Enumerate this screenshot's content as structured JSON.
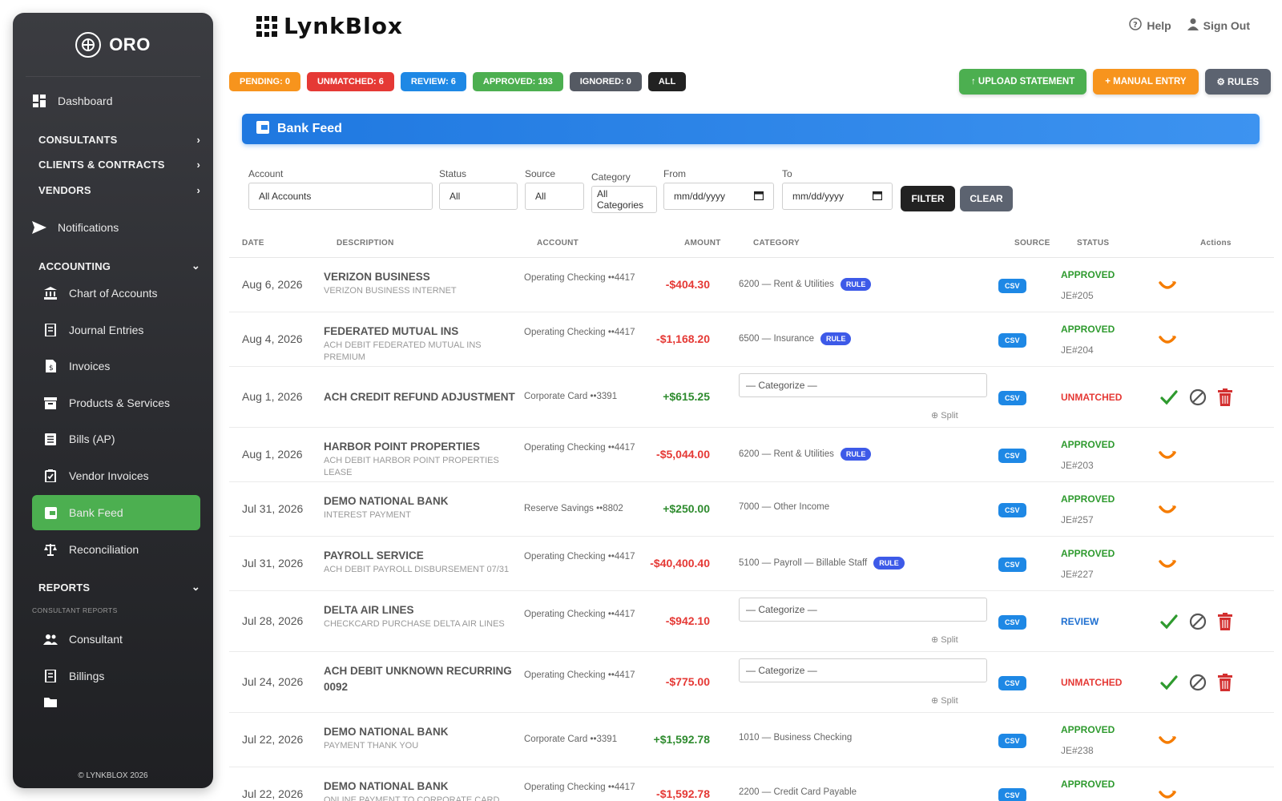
{
  "sidebar": {
    "brand": "ORO",
    "footer": "© LYNKBLOX 2026",
    "dashboard": "Dashboard",
    "sections": {
      "consultants": "CONSULTANTS",
      "clients": "CLIENTS & CONTRACTS",
      "vendors": "VENDORS",
      "accounting": "ACCOUNTING",
      "reports": "REPORTS"
    },
    "notifications": "Notifications",
    "accounting_items": [
      "Chart of Accounts",
      "Journal Entries",
      "Invoices",
      "Products & Services",
      "Bills (AP)",
      "Vendor Invoices",
      "Bank Feed",
      "Reconciliation"
    ],
    "reports_caption": "CONSULTANT REPORTS",
    "reports_items": [
      "Consultant",
      "Billings"
    ]
  },
  "header": {
    "logo": "LynkBlox",
    "help": "Help",
    "signout": "Sign Out"
  },
  "pills": {
    "pending": "PENDING: 0",
    "unmatched": "UNMATCHED: 6",
    "review": "REVIEW: 6",
    "approved": "APPROVED: 193",
    "ignored": "IGNORED: 0",
    "all": "ALL"
  },
  "actions": {
    "upload": "↑ UPLOAD STATEMENT",
    "manual": "+ MANUAL ENTRY",
    "rules": "⚙ RULES"
  },
  "panel": {
    "title": "Bank Feed"
  },
  "filters": {
    "account_label": "Account",
    "account_value": "All Accounts",
    "status_label": "Status",
    "status_value": "All",
    "source_label": "Source",
    "source_value": "All",
    "category_label": "Category",
    "category_value": "All Categories",
    "from_label": "From",
    "from_value": "mm/dd/yyyy",
    "to_label": "To",
    "to_value": "mm/dd/yyyy",
    "filter_btn": "FILTER",
    "clear_btn": "CLEAR"
  },
  "table": {
    "headers": {
      "date": "DATE",
      "description": "DESCRIPTION",
      "account": "ACCOUNT",
      "amount": "AMOUNT",
      "category": "CATEGORY",
      "source": "SOURCE",
      "status": "STATUS",
      "actions": "Actions"
    },
    "categorize_placeholder": "— Categorize —",
    "split_label": "⊕ Split",
    "rule_label": "RULE",
    "csv_label": "CSV",
    "rows": [
      {
        "date": "Aug 6, 2026",
        "title": "VERIZON BUSINESS",
        "sub": "VERIZON BUSINESS INTERNET",
        "account": "Operating Checking ••4417",
        "amount": "-$404.30",
        "sign": "neg",
        "category": "6200 — Rent & Utilities",
        "rule": true,
        "status": "APPROVED",
        "je": "JE#205"
      },
      {
        "date": "Aug 4, 2026",
        "title": "FEDERATED MUTUAL INS",
        "sub": "ACH DEBIT FEDERATED MUTUAL INS PREMIUM",
        "account": "Operating Checking ••4417",
        "amount": "-$1,168.20",
        "sign": "neg",
        "category": "6500 — Insurance",
        "rule": true,
        "status": "APPROVED",
        "je": "JE#204"
      },
      {
        "date": "Aug 1, 2026",
        "title": "ACH CREDIT REFUND ADJUSTMENT",
        "sub": "",
        "account": "Corporate Card ••3391",
        "amount": "+$615.25",
        "sign": "pos",
        "category": "",
        "rule": false,
        "status": "UNMATCHED",
        "je": ""
      },
      {
        "date": "Aug 1, 2026",
        "title": "HARBOR POINT PROPERTIES",
        "sub": "ACH DEBIT HARBOR POINT PROPERTIES LEASE",
        "account": "Operating Checking ••4417",
        "amount": "-$5,044.00",
        "sign": "neg",
        "category": "6200 — Rent & Utilities",
        "rule": true,
        "status": "APPROVED",
        "je": "JE#203"
      },
      {
        "date": "Jul 31, 2026",
        "title": "DEMO NATIONAL BANK",
        "sub": "INTEREST PAYMENT",
        "account": "Reserve Savings ••8802",
        "amount": "+$250.00",
        "sign": "pos",
        "category": "7000 — Other Income",
        "rule": false,
        "status": "APPROVED",
        "je": "JE#257"
      },
      {
        "date": "Jul 31, 2026",
        "title": "PAYROLL SERVICE",
        "sub": "ACH DEBIT PAYROLL DISBURSEMENT 07/31",
        "account": "Operating Checking ••4417",
        "amount": "-$40,400.40",
        "sign": "neg",
        "category": "5100 — Payroll — Billable Staff",
        "rule": true,
        "status": "APPROVED",
        "je": "JE#227"
      },
      {
        "date": "Jul 28, 2026",
        "title": "DELTA AIR LINES",
        "sub": "CHECKCARD PURCHASE DELTA AIR LINES",
        "account": "Operating Checking ••4417",
        "amount": "-$942.10",
        "sign": "neg",
        "category": "",
        "rule": false,
        "status": "REVIEW",
        "je": ""
      },
      {
        "date": "Jul 24, 2026",
        "title": "ACH DEBIT UNKNOWN RECURRING 0092",
        "sub": "",
        "account": "Operating Checking ••4417",
        "amount": "-$775.00",
        "sign": "neg",
        "category": "",
        "rule": false,
        "status": "UNMATCHED",
        "je": ""
      },
      {
        "date": "Jul 22, 2026",
        "title": "DEMO NATIONAL BANK",
        "sub": "PAYMENT THANK YOU",
        "account": "Corporate Card ••3391",
        "amount": "+$1,592.78",
        "sign": "pos",
        "category": "1010 — Business Checking",
        "rule": false,
        "status": "APPROVED",
        "je": "JE#238"
      },
      {
        "date": "Jul 22, 2026",
        "title": "DEMO NATIONAL BANK",
        "sub": "ONLINE PAYMENT TO CORPORATE CARD",
        "account": "Operating Checking ••4417",
        "amount": "-$1,592.78",
        "sign": "neg",
        "category": "2200 — Credit Card Payable",
        "rule": false,
        "status": "APPROVED",
        "je": ""
      }
    ]
  },
  "colors": {
    "pending": "#f7941d",
    "unmatched": "#e53935",
    "review": "#1e88e5",
    "approved": "#4caf50",
    "ignored": "#555a63",
    "all": "#222222",
    "upload": "#4caf50",
    "manual": "#f7941d",
    "rules": "#5c6370",
    "active_nav": "#4caf50"
  }
}
